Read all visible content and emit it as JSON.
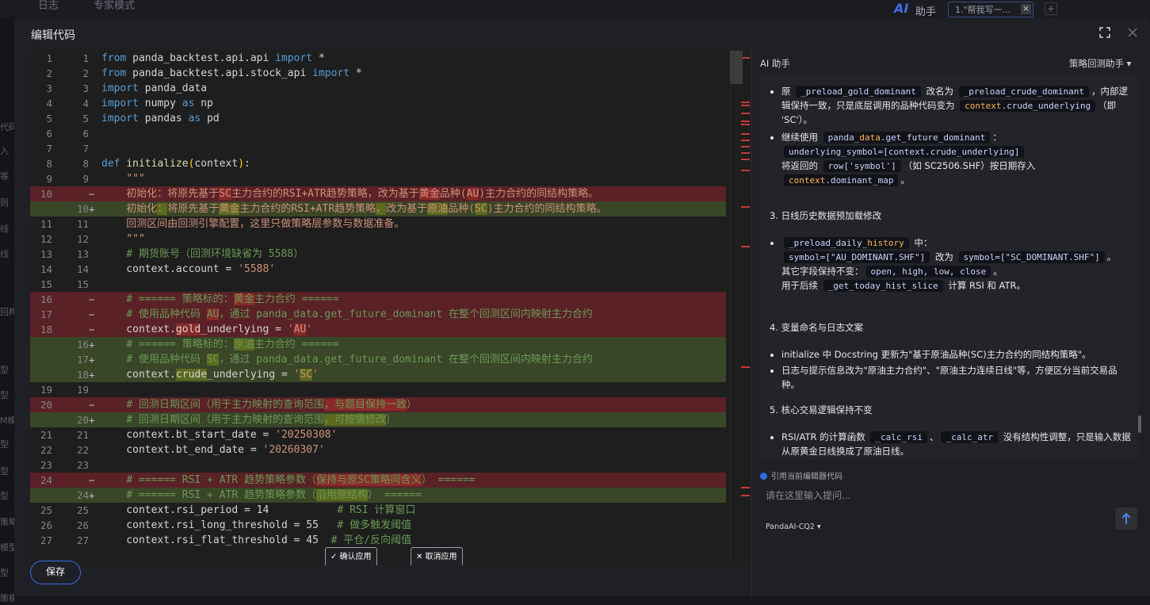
{
  "background": {
    "tabs": [
      "日志",
      "专家模式"
    ],
    "sidebar_labels": [
      "代码",
      "入",
      "等",
      "则",
      "线",
      "线",
      "回构建",
      "型",
      "型",
      "M模",
      "型",
      "型",
      "型",
      "策略",
      "模型",
      "型",
      "策模型"
    ],
    "ai_logo": "AI",
    "ai_title": "助手",
    "ai_tab": "1.\"帮我写一...",
    "ai_tab_close": "×",
    "ai_tab_add": "+"
  },
  "modal": {
    "title": "编辑代码",
    "fullscreen_icon": "fullscreen-icon",
    "close_icon": "close-icon",
    "save_label": "保存"
  },
  "editor": {
    "lines": [
      {
        "l": "1",
        "r": "1",
        "t": "n",
        "code": "<span class=\"k\">from</span> panda_backtest.api.api <span class=\"k\">import</span> *"
      },
      {
        "l": "2",
        "r": "2",
        "t": "n",
        "code": "<span class=\"k\">from</span> panda_backtest.api.stock_api <span class=\"k\">import</span> *"
      },
      {
        "l": "3",
        "r": "3",
        "t": "n",
        "code": "<span class=\"k\">import</span> panda_data"
      },
      {
        "l": "4",
        "r": "4",
        "t": "n",
        "code": "<span class=\"k\">import</span> numpy <span class=\"k\">as</span> np"
      },
      {
        "l": "5",
        "r": "5",
        "t": "n",
        "code": "<span class=\"k\">import</span> pandas <span class=\"k\">as</span> pd"
      },
      {
        "l": "6",
        "r": "6",
        "t": "n",
        "code": ""
      },
      {
        "l": "7",
        "r": "7",
        "t": "n",
        "code": ""
      },
      {
        "l": "8",
        "r": "8",
        "t": "n",
        "code": "<span class=\"k\">def</span> <span class=\"f\">initialize</span><span class=\"pn\">(</span>context<span class=\"pn\">)</span>:"
      },
      {
        "l": "9",
        "r": "9",
        "t": "n",
        "code": "    <span class=\"s\">\"\"\"</span>"
      },
      {
        "l": "10",
        "r": "",
        "t": "d",
        "code": "<span class=\"s\">    初始化：将原先基于<span class=\"hl\">SC</span>主力合约的RSI+ATR趋势策略，改为基于<span class=\"hl\">黄金</span>品种(<span class=\"hl\">AU</span>)主力合约的同结构策略。</span>"
      },
      {
        "l": "",
        "r": "10",
        "t": "a",
        "code": "<span class=\"s\">    初始化<span class=\"hl\">：</span>将原先基于<span class=\"hl\">黄金</span>主力合约的RSI+ATR趋势策略<span class=\"hl\">，</span>改为基于<span class=\"hl\">原油</span>品种(<span class=\"hl\">SC</span>)主力合约的同结构策略。</span>"
      },
      {
        "l": "11",
        "r": "11",
        "t": "n",
        "code": "<span class=\"s\">    回测区间由回测引擎配置，这里只做策略层参数与数据准备。</span>"
      },
      {
        "l": "12",
        "r": "12",
        "t": "n",
        "code": "    <span class=\"s\">\"\"\"</span>"
      },
      {
        "l": "13",
        "r": "13",
        "t": "n",
        "code": "    <span class=\"c\"># 期货账号（回测环境缺省为 5588）</span>"
      },
      {
        "l": "14",
        "r": "14",
        "t": "n",
        "code": "    context.account = <span class=\"s\">'5588'</span>"
      },
      {
        "l": "15",
        "r": "15",
        "t": "n",
        "code": ""
      },
      {
        "l": "16",
        "r": "",
        "t": "d",
        "code": "    <span class=\"c\"># ====== 策略标的：<span class=\"hl\">黄金</span>主力合约 ======</span>"
      },
      {
        "l": "17",
        "r": "",
        "t": "d",
        "code": "    <span class=\"c\"># 使用品种代码 <span class=\"hl\">AU</span>，通过 panda_data.get_future_dominant 在整个回测区间内映射主力合约</span>"
      },
      {
        "l": "18",
        "r": "",
        "t": "d",
        "code": "    context.<span class=\"hl\">gold</span>_underlying = <span class=\"s\">'<span class=\"hl\">AU</span>'</span>"
      },
      {
        "l": "",
        "r": "16",
        "t": "a",
        "code": "    <span class=\"c\"># ====== 策略标的：<span class=\"hl\">原油</span>主力合约 ======</span>"
      },
      {
        "l": "",
        "r": "17",
        "t": "a",
        "code": "    <span class=\"c\"># 使用品种代码 <span class=\"hl\">SC</span>，通过 panda_data.get_future_dominant 在整个回测区间内映射主力合约</span>"
      },
      {
        "l": "",
        "r": "18",
        "t": "a",
        "code": "    context.<span class=\"hl\">crude</span>_underlying = <span class=\"s\">'<span class=\"hl\">SC</span>'</span>"
      },
      {
        "l": "19",
        "r": "19",
        "t": "n",
        "code": ""
      },
      {
        "l": "20",
        "r": "",
        "t": "d",
        "code": "    <span class=\"c\"># 回测日期区间（用于主力映射的查询范围<span class=\"hl\">，与题目保持一致</span>）</span>"
      },
      {
        "l": "",
        "r": "20",
        "t": "a",
        "code": "    <span class=\"c\"># 回测日期区间（用于主力映射的查询范围<span class=\"hl\">，可按需修改</span>）</span>"
      },
      {
        "l": "21",
        "r": "21",
        "t": "n",
        "code": "    context.bt_start_date = <span class=\"s\">'20250308'</span>"
      },
      {
        "l": "22",
        "r": "22",
        "t": "n",
        "code": "    context.bt_end_date = <span class=\"s\">'20260307'</span>"
      },
      {
        "l": "23",
        "r": "23",
        "t": "n",
        "code": ""
      },
      {
        "l": "24",
        "r": "",
        "t": "d",
        "code": "    <span class=\"c\"># ====== RSI + ATR 趋势策略参数（<span class=\"hl\">保持与原SC策略同含义</span>） ======</span>"
      },
      {
        "l": "",
        "r": "24",
        "t": "a",
        "code": "    <span class=\"c\"># ====== RSI + ATR 趋势策略参数（<span class=\"hl\">沿用原结构</span>） ======</span>"
      },
      {
        "l": "25",
        "r": "25",
        "t": "n",
        "code": "    context.rsi_period = 14           <span class=\"c\"># RSI 计算窗口</span>"
      },
      {
        "l": "26",
        "r": "26",
        "t": "n",
        "code": "    context.rsi_long_threshold = 55   <span class=\"c\"># 做多触发阈值</span>"
      },
      {
        "l": "27",
        "r": "27",
        "t": "n",
        "code": "    context.rsi_flat_threshold = 45  <span class=\"c\"># 平仓/反向阈值</span>"
      }
    ],
    "accept_label": "✓ 确认应用",
    "reject_label": "✕ 取消应用",
    "colors": {
      "deleted": "#5a2127",
      "added": "#3a4628",
      "minimap_deleted": "#c53a3a",
      "minimap_added": "#8fa33a"
    }
  },
  "ai": {
    "title": "AI 助手",
    "mode_select": "策略回测助手 ▾",
    "cite_label": "引用当前编辑器代码",
    "input_placeholder": "请在这里输入提问...",
    "model_select": "PandaAI-CQ2 ▾",
    "send_icon": "send-arrow-icon",
    "messages": [
      "<ul style=\"padding-left:15px\"><li>原 <span class=\"ic\">_preload_gold_dominant</span> 改名为 <span class=\"ic\">_preload_crude_dominant</span>，内部逻辑保持一致，只是底层调用的品种代码变为 <span class=\"ic\"><span class=\"y\">context</span>.crude_underlying</span>（即 'SC'）。</li><li style=\"margin-top:4px\">继续使用 <span class=\"ic\">panda_<span class=\"y\">data</span>.get_future_dominant</span>：<br><span class=\"ic\">underlying_symbol=[context.crude_underlying]</span><br>将返回的 <span class=\"ic\">row['symbol']</span>（如 SC2506.SHF）按日期存入 <span class=\"ic\"><span class=\"y\">context</span>.dominant_map</span>。</li></ul>",
      "3. 日线历史数据预加载修改",
      "<ul style=\"padding-left:15px\"><li><span class=\"ic\">_preload_daily_<span class=\"y\">history</span></span> 中：<br><span class=\"ic\">symbol=[\"AU_DOMINANT.SHF\"]</span> 改为 <span class=\"ic\">symbol=[\"SC_DOMINANT.SHF\"]</span>。<br>其它字段保持不变：<span class=\"ic\">open, high, low, close</span>。<br>用于后续 <span class=\"ic\">_get_today_hist_slice</span> 计算 RSI 和 ATR。</li></ul>",
      "4. 变量命名与日志文案",
      "<ul style=\"padding-left:15px\"><li>initialize 中 Docstring 更新为\"基于原油品种(SC)主力合约的同结构策略\"。</li><li style=\"margin-top:2px\">日志与提示信息改为\"原油主力合约\"、\"原油主力连续日线\"等，方便区分当前交易品种。</li></ul>",
      "5. 核心交易逻辑保持不变",
      "<ul style=\"padding-left:15px\"><li>RSI/ATR 的计算函数 <span class=\"ic\">_calc_rsi</span>、<span class=\"ic\">_calc_atr</span> 没有结构性调整，只是输入数据从原黄金日线换成了原油日线。</li></ul>"
    ]
  }
}
